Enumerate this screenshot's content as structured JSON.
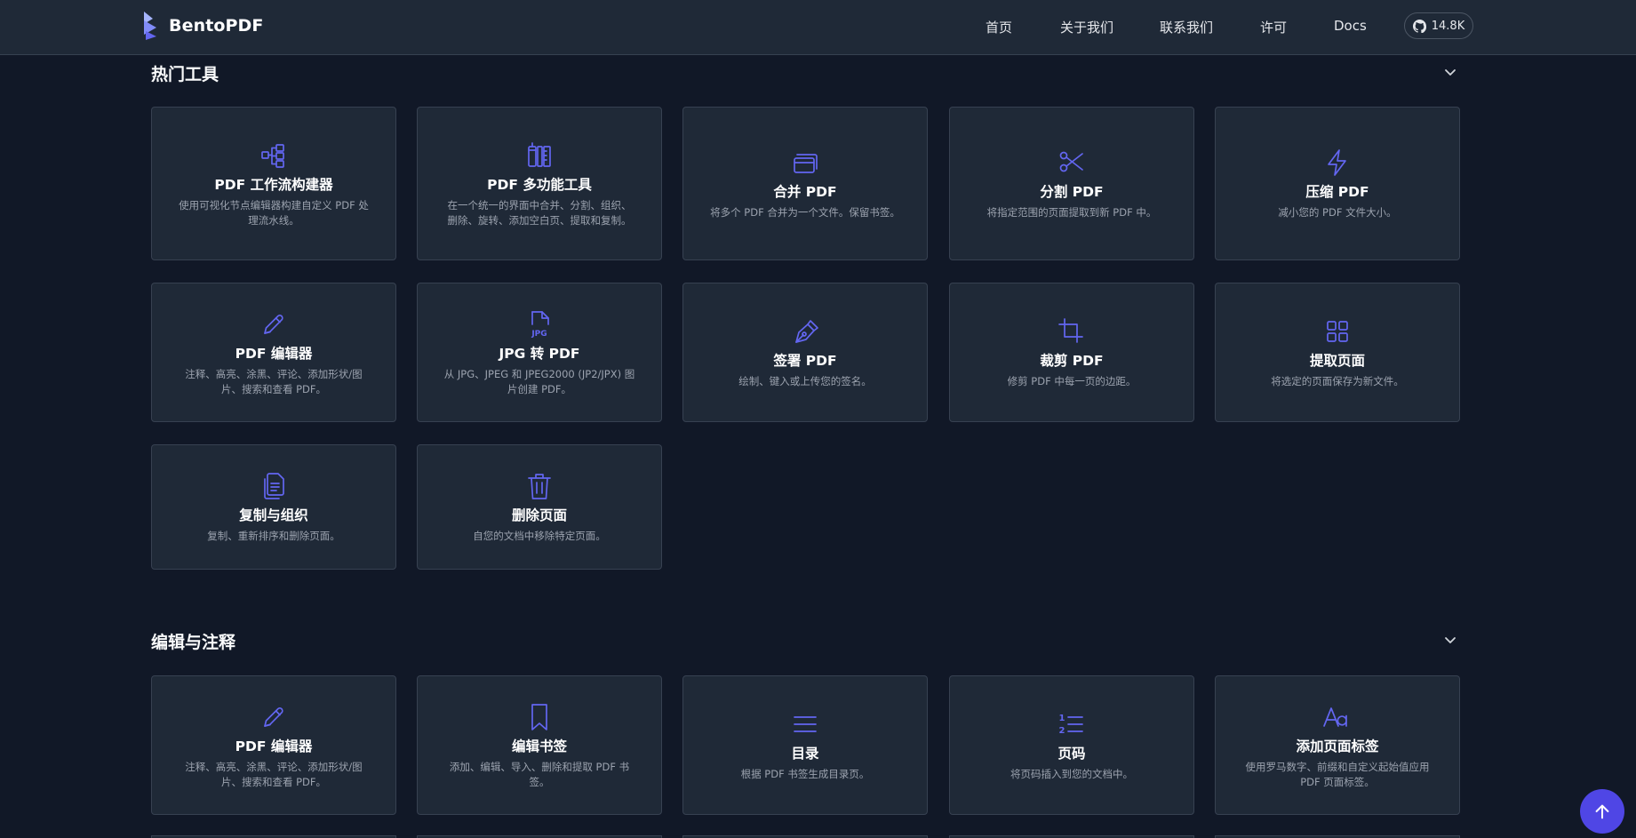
{
  "header": {
    "brand": "BentoPDF",
    "nav": [
      {
        "label": "首页",
        "key": "home"
      },
      {
        "label": "关于我们",
        "key": "about"
      },
      {
        "label": "联系我们",
        "key": "contact"
      },
      {
        "label": "许可",
        "key": "license"
      },
      {
        "label": "Docs",
        "key": "docs"
      }
    ],
    "github_stars": "14.8K"
  },
  "sections": [
    {
      "title": "热门工具",
      "cards": [
        {
          "icon": "workflow-icon",
          "title": "PDF 工作流构建器",
          "desc": "使用可视化节点编辑器构建自定义 PDF 处理流水线。"
        },
        {
          "icon": "multitool-icon",
          "title": "PDF 多功能工具",
          "desc": "在一个统一的界面中合并、分割、组织、删除、旋转、添加空白页、提取和复制。"
        },
        {
          "icon": "merge-icon",
          "title": "合并 PDF",
          "desc": "将多个 PDF 合并为一个文件。保留书签。"
        },
        {
          "icon": "scissors-icon",
          "title": "分割 PDF",
          "desc": "将指定范围的页面提取到新 PDF 中。"
        },
        {
          "icon": "lightning-icon",
          "title": "压缩 PDF",
          "desc": "减小您的 PDF 文件大小。"
        },
        {
          "icon": "pencil-icon",
          "title": "PDF 编辑器",
          "desc": "注释、高亮、涂黑、评论、添加形状/图片、搜索和查看 PDF。"
        },
        {
          "icon": "jpg-file-icon",
          "title": "JPG 转 PDF",
          "desc": "从 JPG、JPEG 和 JPEG2000 (JP2/JPX) 图片创建 PDF。"
        },
        {
          "icon": "pen-nib-icon",
          "title": "签署 PDF",
          "desc": "绘制、键入或上传您的签名。"
        },
        {
          "icon": "crop-icon",
          "title": "裁剪 PDF",
          "desc": "修剪 PDF 中每一页的边距。"
        },
        {
          "icon": "grid-icon",
          "title": "提取页面",
          "desc": "将选定的页面保存为新文件。"
        },
        {
          "icon": "copy-files-icon",
          "title": "复制与组织",
          "desc": "复制、重新排序和删除页面。"
        },
        {
          "icon": "trash-icon",
          "title": "删除页面",
          "desc": "自您的文档中移除特定页面。"
        }
      ]
    },
    {
      "title": "编辑与注释",
      "cards": [
        {
          "icon": "pencil-icon",
          "title": "PDF 编辑器",
          "desc": "注释、高亮、涂黑、评论、添加形状/图片、搜索和查看 PDF。"
        },
        {
          "icon": "bookmark-icon",
          "title": "编辑书签",
          "desc": "添加、编辑、导入、删除和提取 PDF 书签。"
        },
        {
          "icon": "list-icon",
          "title": "目录",
          "desc": "根据 PDF 书签生成目录页。"
        },
        {
          "icon": "numbered-list-icon",
          "title": "页码",
          "desc": "将页码插入到您的文档中。"
        },
        {
          "icon": "text-aa-icon",
          "title": "添加页面标签",
          "desc": "使用罗马数字、前缀和自定义起始值应用 PDF 页面标签。"
        }
      ]
    }
  ],
  "colors": {
    "accent": "#6366f1",
    "fab": "#4f46e5",
    "bg": "#111827",
    "card": "#1f2937"
  }
}
